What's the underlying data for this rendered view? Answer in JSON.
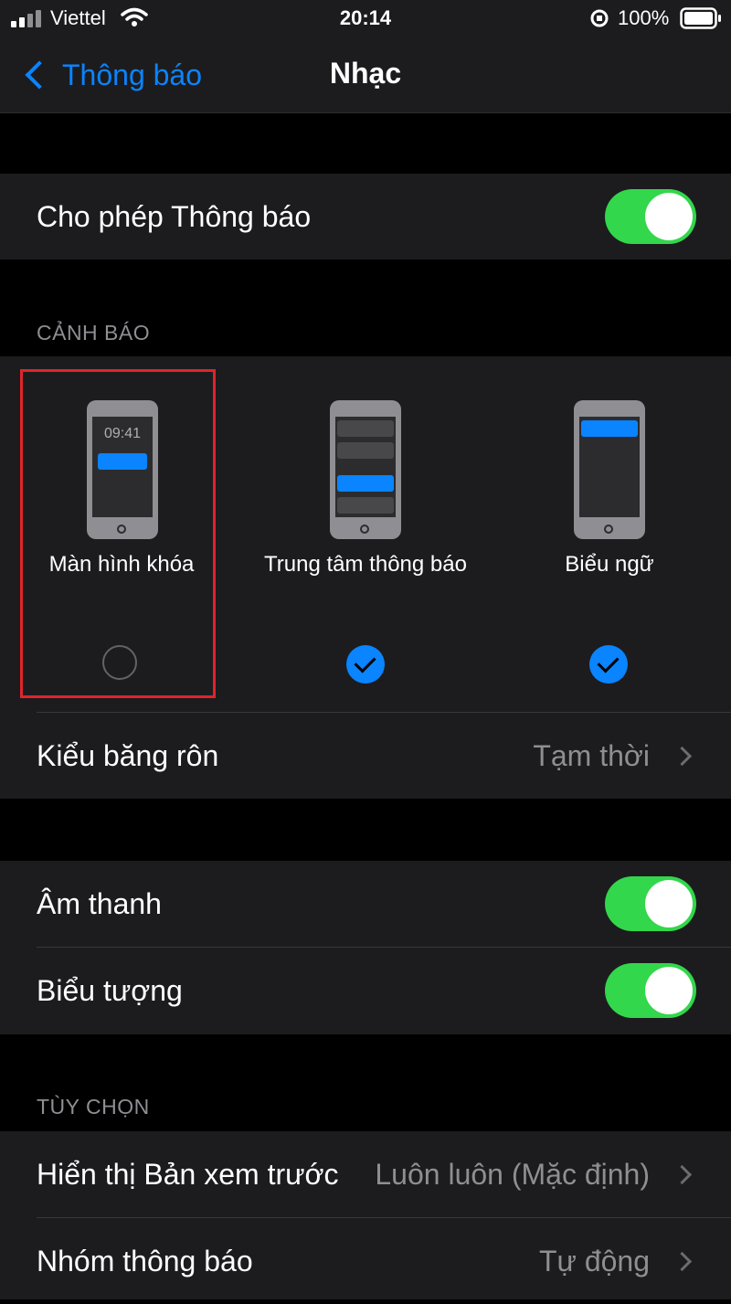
{
  "status_bar": {
    "carrier": "Viettel",
    "time": "20:14",
    "battery": "100%"
  },
  "nav": {
    "back_label": "Thông báo",
    "title": "Nhạc"
  },
  "allow_notifications": {
    "label": "Cho phép Thông báo",
    "enabled": true
  },
  "alerts": {
    "header": "CẢNH BÁO",
    "options": [
      {
        "label": "Màn hình khóa",
        "clock": "09:41",
        "checked": false
      },
      {
        "label": "Trung tâm thông báo",
        "checked": true
      },
      {
        "label": "Biểu ngữ",
        "checked": true
      }
    ]
  },
  "banner_style": {
    "label": "Kiểu băng rôn",
    "value": "Tạm thời"
  },
  "sounds": {
    "label": "Âm thanh",
    "enabled": true
  },
  "badges": {
    "label": "Biểu tượng",
    "enabled": true
  },
  "options": {
    "header": "TÙY CHỌN",
    "show_previews": {
      "label": "Hiển thị Bản xem trước",
      "value": "Luôn luôn (Mặc định)"
    },
    "grouping": {
      "label": "Nhóm thông báo",
      "value": "Tự động"
    }
  },
  "colors": {
    "accent": "#0a84ff",
    "toggle_on": "#32d74b",
    "highlight": "#e0242b",
    "background": "#000000",
    "group_bg": "#1c1c1e"
  }
}
